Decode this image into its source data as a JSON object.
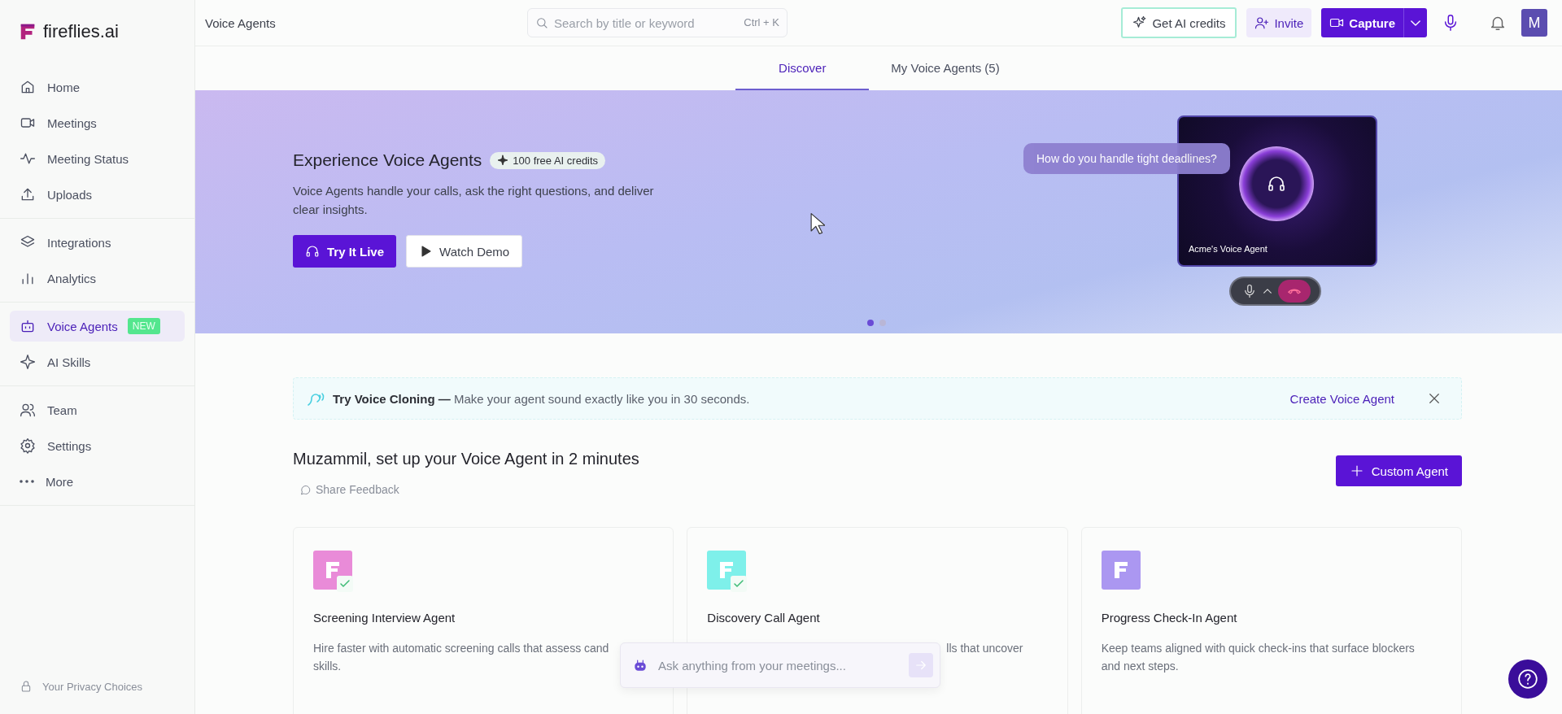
{
  "brand": {
    "name": "fireflies.ai"
  },
  "sidebar": {
    "groups": [
      {
        "items": [
          {
            "label": "Home",
            "selected": false
          },
          {
            "label": "Meetings",
            "selected": false
          },
          {
            "label": "Meeting Status",
            "selected": false
          },
          {
            "label": "Uploads",
            "selected": false
          }
        ]
      },
      {
        "items": [
          {
            "label": "Integrations",
            "selected": false
          },
          {
            "label": "Analytics",
            "selected": false
          }
        ]
      },
      {
        "items": [
          {
            "label": "Voice Agents",
            "selected": true,
            "badge": "NEW"
          },
          {
            "label": "AI Skills",
            "selected": false
          }
        ]
      },
      {
        "items": [
          {
            "label": "Team",
            "selected": false
          },
          {
            "label": "Settings",
            "selected": false
          },
          {
            "label": "More",
            "selected": false
          }
        ]
      }
    ],
    "footer": "Your Privacy Choices"
  },
  "topbar": {
    "title": "Voice Agents",
    "search": {
      "placeholder": "Search by title or keyword",
      "shortcut": "Ctrl + K"
    },
    "credits_button": "Get AI credits",
    "invite_button": "Invite",
    "capture_button": "Capture",
    "avatar": "M"
  },
  "tabs": [
    {
      "label": "Discover",
      "selected": true
    },
    {
      "label": "My Voice Agents (5)",
      "selected": false
    }
  ],
  "hero": {
    "title": "Experience Voice Agents",
    "badge": "100 free AI credits",
    "description": "Voice Agents handle your calls, ask the right questions, and deliver clear insights.",
    "primary_button": "Try It Live",
    "secondary_button": "Watch Demo",
    "bubble": "How do you handle tight deadlines?",
    "agent_label": "Acme's Voice Agent",
    "dots": [
      {
        "selected": true
      },
      {
        "selected": false
      }
    ]
  },
  "banner": {
    "text": "**Try Voice Cloning —** Make your agent sound exactly like you in 30 seconds.",
    "link": "Create Voice Agent"
  },
  "setup": {
    "heading": "Muzammil, set up your Voice Agent in 2 minutes",
    "feedback": "Share Feedback",
    "custom_button": "Custom Agent"
  },
  "cards": [
    {
      "title": "Screening Interview Agent",
      "color": "#e98bd8",
      "checked": true,
      "lines": [
        "Hire faster with automatic screening calls that assess cand",
        "skills."
      ]
    },
    {
      "title": "Discovery Call Agent",
      "color": "#7ef0ea",
      "checked": true,
      "lines": [
        "lls that uncover"
      ]
    },
    {
      "title": "Progress Check-In Agent",
      "color": "#ab97f1",
      "checked": false,
      "lines": [
        "Keep teams aligned with quick check-ins that surface blockers",
        "and next steps."
      ]
    }
  ],
  "ask_bar": {
    "placeholder": "Ask anything from your meetings..."
  }
}
